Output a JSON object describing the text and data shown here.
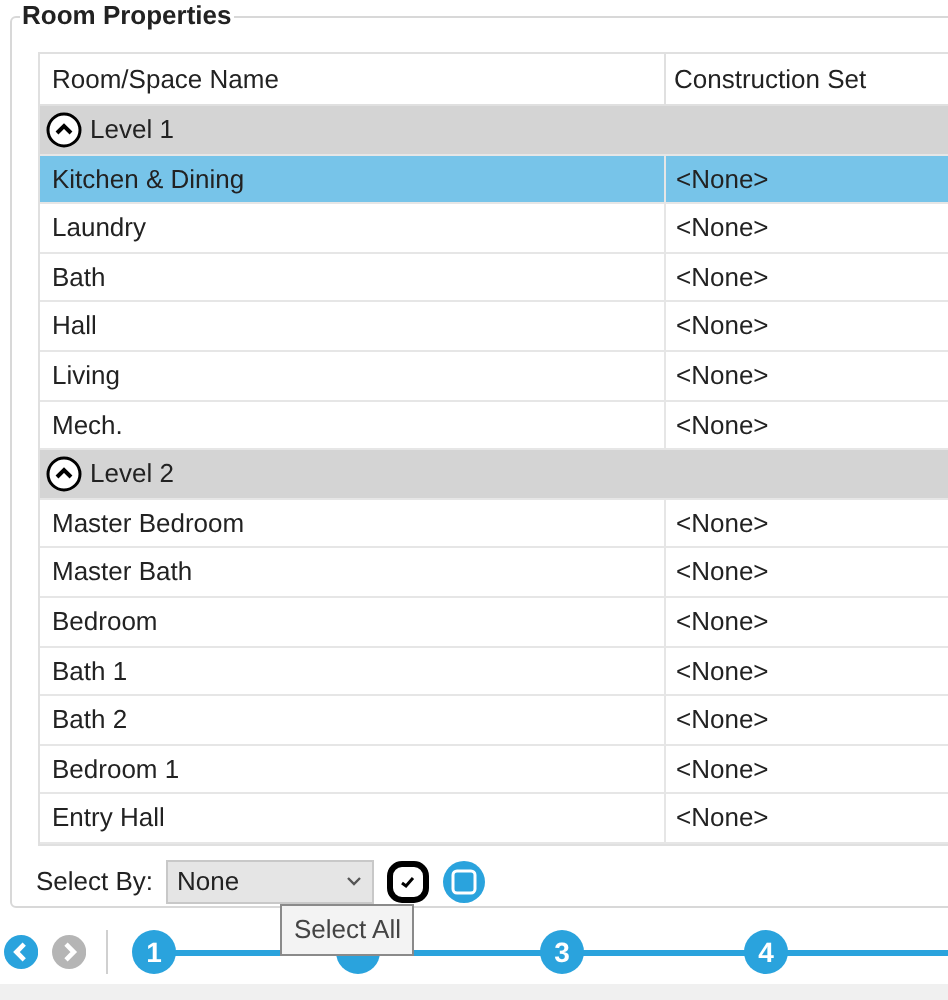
{
  "panel": {
    "title": "Room Properties"
  },
  "table": {
    "columns": [
      "Room/Space Name",
      "Construction Set"
    ],
    "groups": [
      {
        "label": "Level 1",
        "expanded": true,
        "rows": [
          {
            "name": "Kitchen & Dining",
            "construction_set": "<None>",
            "selected": true
          },
          {
            "name": "Laundry",
            "construction_set": "<None>",
            "selected": false
          },
          {
            "name": "Bath",
            "construction_set": "<None>",
            "selected": false
          },
          {
            "name": "Hall",
            "construction_set": "<None>",
            "selected": false
          },
          {
            "name": "Living",
            "construction_set": "<None>",
            "selected": false
          },
          {
            "name": "Mech.",
            "construction_set": "<None>",
            "selected": false
          }
        ]
      },
      {
        "label": "Level 2",
        "expanded": true,
        "rows": [
          {
            "name": "Master Bedroom",
            "construction_set": "<None>",
            "selected": false
          },
          {
            "name": "Master Bath",
            "construction_set": "<None>",
            "selected": false
          },
          {
            "name": "Bedroom",
            "construction_set": "<None>",
            "selected": false
          },
          {
            "name": "Bath 1",
            "construction_set": "<None>",
            "selected": false
          },
          {
            "name": "Bath 2",
            "construction_set": "<None>",
            "selected": false
          },
          {
            "name": "Bedroom 1",
            "construction_set": "<None>",
            "selected": false
          },
          {
            "name": "Entry Hall",
            "construction_set": "<None>",
            "selected": false
          }
        ]
      }
    ]
  },
  "select_by": {
    "label": "Select By:",
    "value": "None"
  },
  "tooltip": "Select All",
  "nav": {
    "back_disabled": false,
    "forward_disabled": true
  },
  "steps": [
    {
      "kind": "step",
      "label": "1"
    },
    {
      "kind": "covered"
    },
    {
      "kind": "step",
      "label": "3"
    },
    {
      "kind": "step",
      "label": "4"
    }
  ]
}
